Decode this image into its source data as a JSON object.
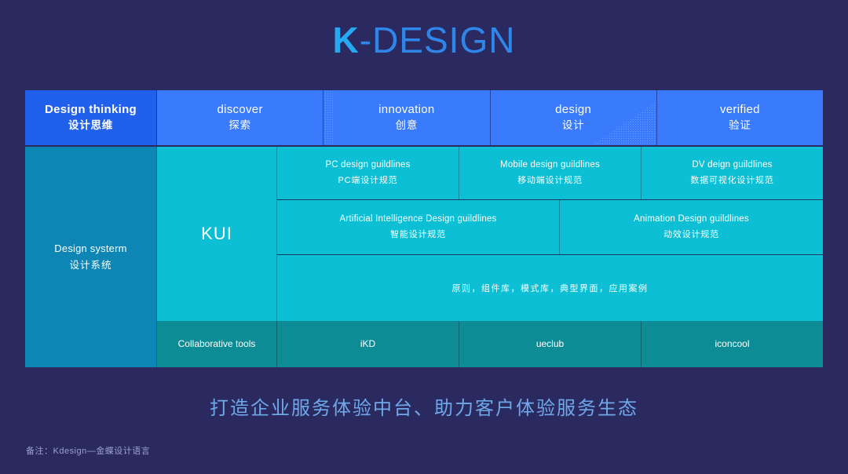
{
  "title": {
    "bold": "K",
    "rest": "-DESIGN"
  },
  "header": {
    "cells": [
      {
        "en": "Design thinking",
        "cn": "设计思维"
      },
      {
        "en": "discover",
        "cn": "探索"
      },
      {
        "en": "innovation",
        "cn": "创意"
      },
      {
        "en": "design",
        "cn": "设计"
      },
      {
        "en": "verified",
        "cn": "验证"
      }
    ]
  },
  "system": {
    "en": "Design systerm",
    "cn": "设计系统"
  },
  "kui": {
    "label": "KUI"
  },
  "guidelines": {
    "row1": [
      {
        "en": "PC design guildlines",
        "cn": "PC端设计规范"
      },
      {
        "en": "Mobile design guildlines",
        "cn": "移动端设计规范"
      },
      {
        "en": "DV deign guildlines",
        "cn": "数据可视化设计规范"
      }
    ],
    "row2": [
      {
        "en": "Artificial Intelligence Design guildlines",
        "cn": "智能设计规范"
      },
      {
        "en": "Animation Design guildlines",
        "cn": "动效设计规范"
      }
    ],
    "row3": {
      "cn": "原则，组件库，模式库，典型界面，应用案例"
    }
  },
  "tools": {
    "label": "Collaborative tools",
    "items": [
      {
        "name": "iKD"
      },
      {
        "name": "ueclub"
      },
      {
        "name": "iconcool"
      }
    ]
  },
  "tagline": "打造企业服务体验中台、助力客户体验服务生态",
  "footnote": "备注：Kdesign—金蝶设计语言",
  "colors": {
    "background": "#2b2a60",
    "header_primary": "#2160ea",
    "header_step": "#3a7afc",
    "system": "#0d86b5",
    "guideline": "#0cbfd4",
    "tools": "#0d8c96",
    "title_accent": "#29a8f2",
    "title_text": "#2f86e8",
    "tagline": "#6fa8e8"
  }
}
